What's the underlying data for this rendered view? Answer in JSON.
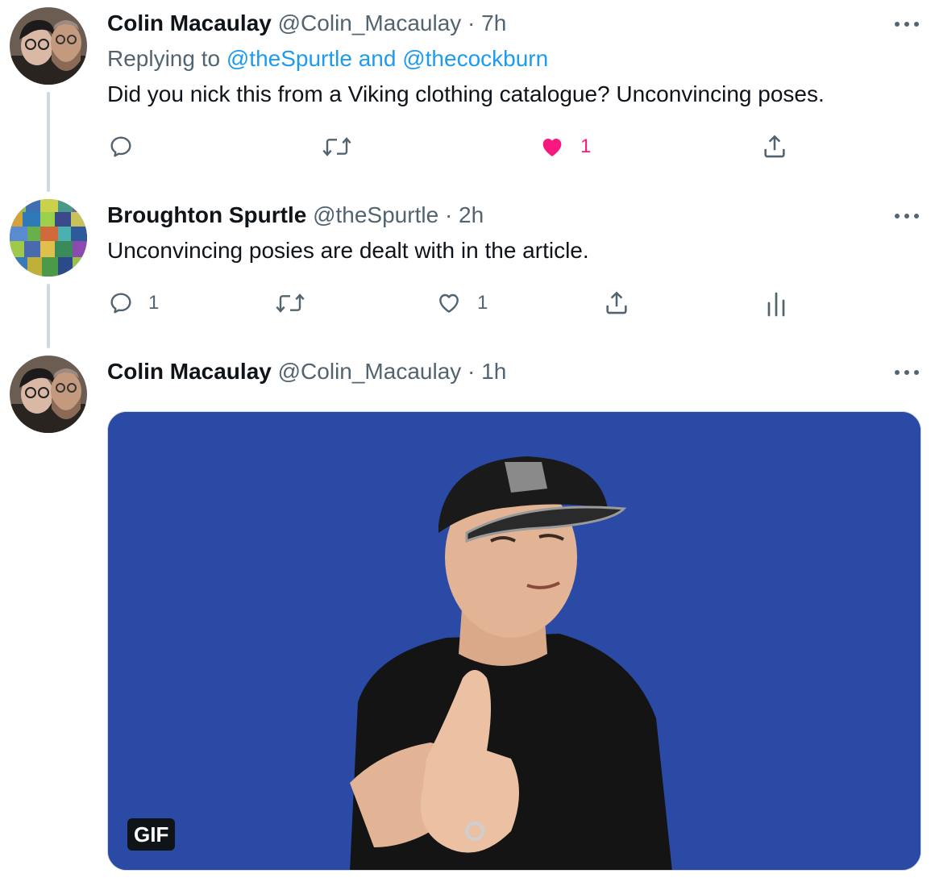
{
  "tweets": [
    {
      "name": "Colin Macaulay",
      "handle": "@Colin_Macaulay",
      "time": "· 7h",
      "replying_label": "Replying to",
      "replying_mentions": "@theSpurtle and @thecockburn",
      "text": "Did you nick this from a Viking clothing catalogue? Unconvincing poses.",
      "likes": "1",
      "liked": true
    },
    {
      "name": "Broughton Spurtle",
      "handle": "@theSpurtle",
      "time": "· 2h",
      "text": "Unconvincing posies are dealt with in the article.",
      "replies": "1",
      "likes": "1"
    },
    {
      "name": "Colin Macaulay",
      "handle": "@Colin_Macaulay",
      "time": "· 1h",
      "media_badge": "GIF"
    }
  ],
  "colors": {
    "accent": "#1d9bf0",
    "like": "#f91880",
    "muted": "#536471",
    "gif_background": "#2a4aa6"
  },
  "icons": [
    "reply-icon",
    "retweet-icon",
    "like-icon",
    "share-icon",
    "analytics-icon",
    "more-icon"
  ]
}
